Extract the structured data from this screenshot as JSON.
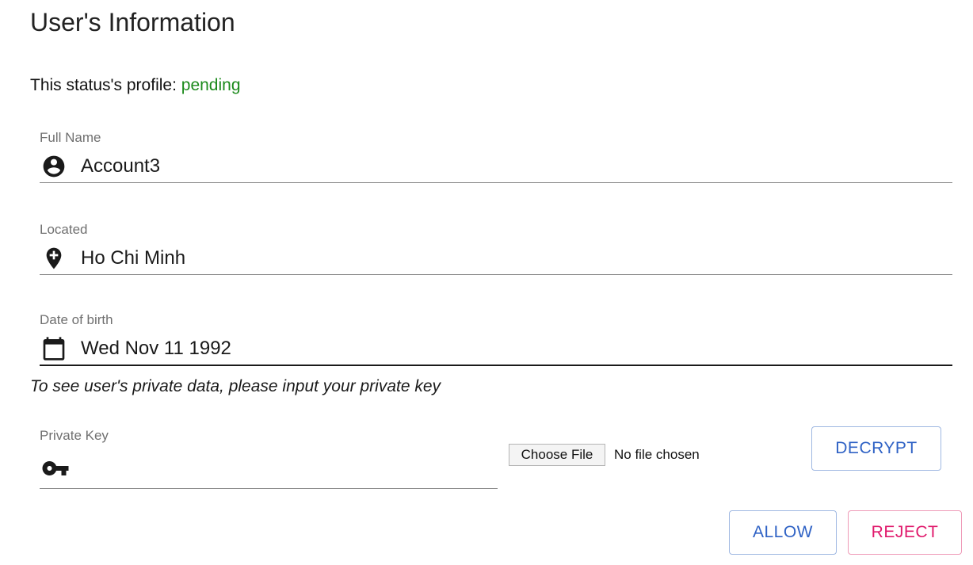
{
  "dialog": {
    "title": "User's Information",
    "status_label": "This status's profile:",
    "status_value": "pending",
    "status_color": "#1b8a1b"
  },
  "fields": {
    "full_name": {
      "label": "Full Name",
      "value": "Account3",
      "icon": "account-circle-icon"
    },
    "located": {
      "label": "Located",
      "value": "Ho Chi Minh",
      "icon": "add-location-icon"
    },
    "dob": {
      "label": "Date of birth",
      "value": "Wed Nov 11 1992",
      "icon": "calendar-icon"
    }
  },
  "private_key": {
    "hint": "To see user's private data, please input your private key",
    "label": "Private Key",
    "icon": "key-icon",
    "file_button": "Choose File",
    "file_status": "No file chosen"
  },
  "buttons": {
    "decrypt": "DECRYPT",
    "allow": "ALLOW",
    "reject": "REJECT"
  },
  "colors": {
    "primary": "#2f62c5",
    "secondary": "#e0196c"
  }
}
